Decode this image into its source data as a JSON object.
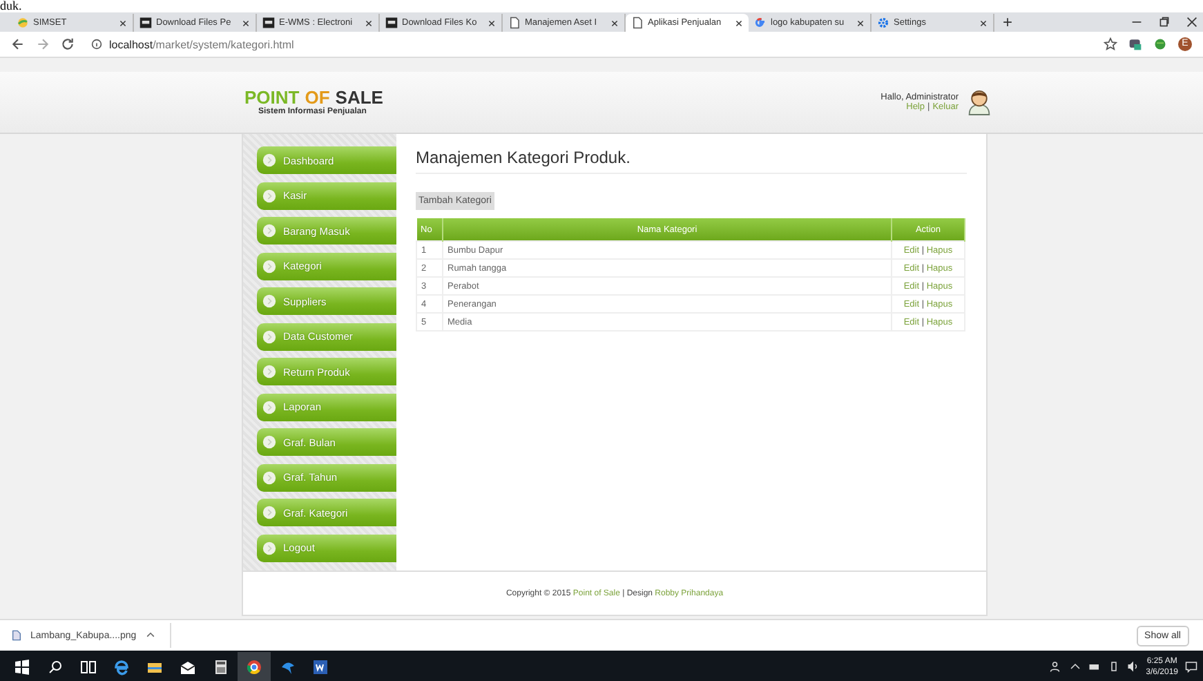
{
  "top_fragment": "duk.",
  "browser": {
    "tabs": [
      {
        "title": "SIMSET",
        "kind": "sun",
        "selected": false
      },
      {
        "title": "Download Files Pe",
        "kind": "mw",
        "selected": false
      },
      {
        "title": "E-WMS : Electroni",
        "kind": "mw",
        "selected": false
      },
      {
        "title": "Download Files Ko",
        "kind": "mw",
        "selected": false
      },
      {
        "title": "Manajemen Aset I",
        "kind": "page",
        "selected": false
      },
      {
        "title": "Aplikasi Penjualan",
        "kind": "page",
        "selected": true
      },
      {
        "title": "logo kabupaten su",
        "kind": "ring",
        "selected": false
      },
      {
        "title": "Settings",
        "kind": "gear",
        "selected": false
      }
    ],
    "new_tab": "+",
    "url_host": "localhost",
    "url_path": "/market/system/kategori.html",
    "profile_initial": "E"
  },
  "header": {
    "logo": [
      "POINT",
      "OF",
      "SALE"
    ],
    "subtitle": "Sistem Informasi Penjualan",
    "greeting": "Hallo, Administrator",
    "links": [
      "Help",
      "|",
      "Keluar"
    ]
  },
  "sidebar": {
    "items": [
      {
        "label": "Dashboard",
        "selected": false
      },
      {
        "label": "Kasir",
        "selected": false
      },
      {
        "label": "Barang Masuk",
        "selected": false
      },
      {
        "label": "Kategori",
        "selected": false
      },
      {
        "label": "Suppliers",
        "selected": false
      },
      {
        "label": "Data Customer",
        "selected": false
      },
      {
        "label": "Return Produk",
        "selected": false
      },
      {
        "label": "Laporan",
        "selected": false
      },
      {
        "label": "Graf. Bulan",
        "selected": false
      },
      {
        "label": "Graf. Tahun",
        "selected": false
      },
      {
        "label": "Graf. Kategori",
        "selected": false
      },
      {
        "label": "Logout",
        "selected": false
      }
    ]
  },
  "content": {
    "title": "Manajemen Kategori Produk.",
    "add_button": "Tambah Kategori",
    "table": {
      "columns": [
        "No",
        "Nama Kategori",
        "Action"
      ],
      "rows": [
        {
          "no": "1",
          "name": "Bumbu Dapur",
          "edit": "Edit",
          "sep": "|",
          "delete": "Hapus"
        },
        {
          "no": "2",
          "name": "Rumah tangga",
          "edit": "Edit",
          "sep": "|",
          "delete": "Hapus"
        },
        {
          "no": "3",
          "name": "Perabot",
          "edit": "Edit",
          "sep": "|",
          "delete": "Hapus"
        },
        {
          "no": "4",
          "name": "Penerangan",
          "edit": "Edit",
          "sep": "|",
          "delete": "Hapus"
        },
        {
          "no": "5",
          "name": "Media",
          "edit": "Edit",
          "sep": "|",
          "delete": "Hapus"
        }
      ]
    }
  },
  "footer": {
    "text_before": "Copyright © 2015 ",
    "link_1": "Point of Sale",
    "text_middle": " | Design ",
    "link_2": "Robby Prihandaya"
  },
  "download_bar": {
    "file": "Lambang_Kabupa....png",
    "show_all": "Show all"
  },
  "taskbar": {
    "time": "6:25 AM",
    "date": "3/6/2019"
  }
}
